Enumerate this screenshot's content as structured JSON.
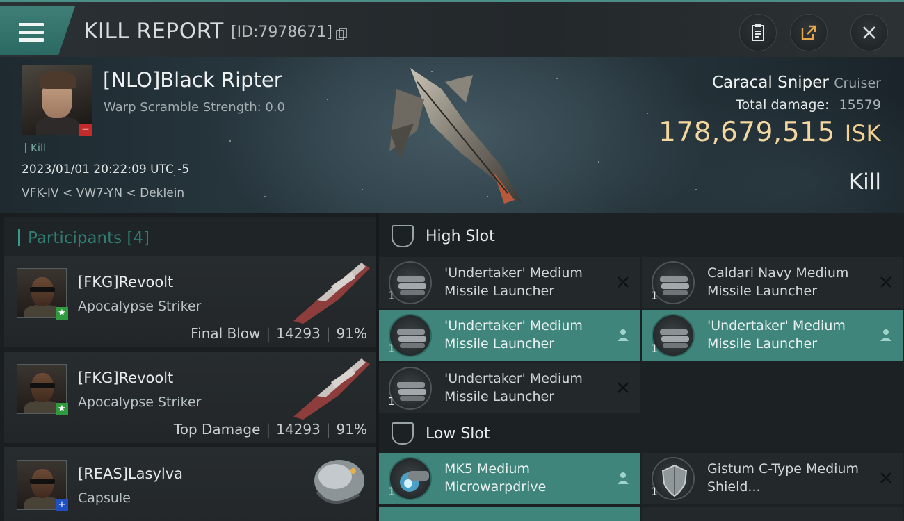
{
  "header": {
    "title": "KILL REPORT",
    "report_id": "[ID:7978671]"
  },
  "victim": {
    "name": "[NLO]Black Ripter",
    "warp_scramble": "Warp Scramble Strength: 0.0",
    "tag": "Kill",
    "datetime": "2023/01/01 20:22:09 UTC -5",
    "location": "VFK-IV < VW7-YN < Deklein",
    "ship": "Caracal Sniper",
    "ship_class": "Cruiser",
    "total_damage_label": "Total damage:",
    "total_damage": "15579",
    "isk_value": "178,679,515",
    "isk_unit": "ISK",
    "outcome": "Kill"
  },
  "participants": {
    "title": "Participants",
    "count": "[4]",
    "items": [
      {
        "name": "[FKG]Revoolt",
        "ship": "Apocalypse Striker",
        "role": "Final Blow",
        "damage": "14293",
        "percent": "91%",
        "badge": "★"
      },
      {
        "name": "[FKG]Revoolt",
        "ship": "Apocalypse Striker",
        "role": "Top Damage",
        "damage": "14293",
        "percent": "91%",
        "badge": "★"
      },
      {
        "name": "[REAS]Lasylva",
        "ship": "Capsule",
        "badge": "+"
      }
    ]
  },
  "fitting": {
    "high_slot": {
      "title": "High Slot",
      "modules": [
        {
          "name": "'Undertaker' Medium Missile Launcher",
          "qty": "1",
          "state": "destroyed"
        },
        {
          "name": "Caldari Navy Medium Missile Launcher",
          "qty": "1",
          "state": "destroyed"
        },
        {
          "name": "'Undertaker' Medium Missile Launcher",
          "qty": "1",
          "state": "dropped"
        },
        {
          "name": "'Undertaker' Medium Missile Launcher",
          "qty": "1",
          "state": "dropped"
        },
        {
          "name": "'Undertaker' Medium Missile Launcher",
          "qty": "1",
          "state": "destroyed"
        }
      ]
    },
    "low_slot": {
      "title": "Low Slot",
      "modules": [
        {
          "name": "MK5 Medium Microwarpdrive",
          "qty": "1",
          "state": "dropped"
        },
        {
          "name": "Gistum C-Type Medium Shield...",
          "qty": "1",
          "state": "destroyed"
        }
      ]
    }
  },
  "colors": {
    "accent": "#3f857b",
    "isk": "#f4d7a0",
    "kill_badge": "#c32a2a"
  }
}
